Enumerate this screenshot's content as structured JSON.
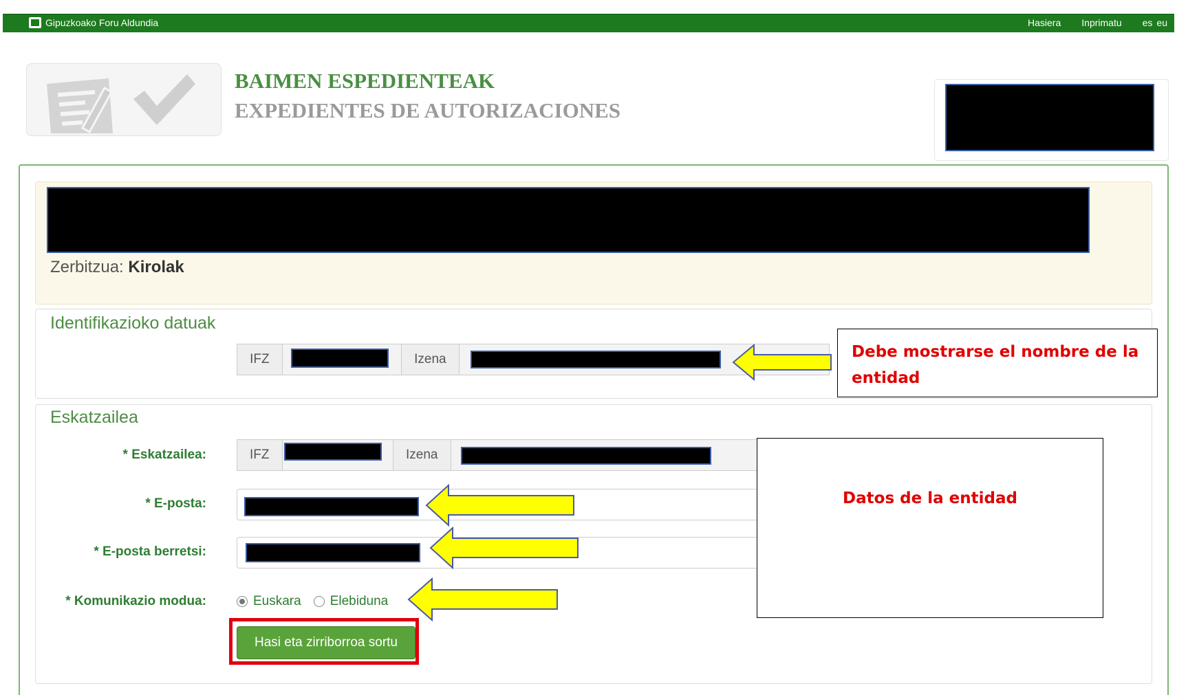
{
  "topbar": {
    "org": "Gipuzkoako Foru Aldundia",
    "links": [
      "Hasiera",
      "Inprimatu"
    ],
    "lang": [
      "es",
      "eu"
    ]
  },
  "header": {
    "title": "BAIMEN ESPEDIENTEAK",
    "subtitle": "EXPEDIENTES DE AUTORIZACIONES"
  },
  "service": {
    "label": "Zerbitzua:",
    "value": "Kirolak"
  },
  "ident": {
    "legend": "Identifikazioko datuak",
    "ifz_label": "IFZ",
    "izena_label": "Izena"
  },
  "eskatzailea": {
    "legend": "Eskatzailea",
    "label": "* Eskatzailea:",
    "ifz_label": "IFZ",
    "izena_label": "Izena",
    "email_label": "* E-posta:",
    "email_confirm_label": "* E-posta berretsi:",
    "comm_label": "* Komunikazio modua:",
    "comm_options": [
      "Euskara",
      "Elebiduna"
    ],
    "comm_selected": "Euskara"
  },
  "submit_button": "Hasi eta zirriborroa sortu",
  "annotations": {
    "note1": "Debe mostrarse el nombre de la entidad",
    "note2": "Datos de la entidad"
  }
}
